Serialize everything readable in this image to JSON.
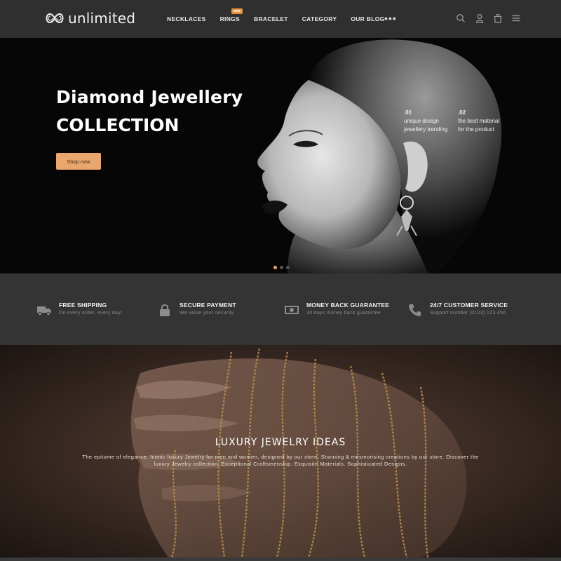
{
  "header": {
    "logo_text": "unlimited",
    "nav": [
      {
        "label": "NECKLACES"
      },
      {
        "label": "RINGS",
        "badge": "sale"
      },
      {
        "label": "BRACELET"
      },
      {
        "label": "CATEGORY"
      },
      {
        "label": "OUR BLOG"
      }
    ],
    "more_label": "•••",
    "icons": [
      "search-icon",
      "user-icon",
      "cart-icon",
      "menu-icon"
    ]
  },
  "hero": {
    "title": "Diamond Jewellery",
    "subtitle": "COLLECTION",
    "button_label": "Shop now",
    "features": [
      {
        "num": ".01",
        "line1": "unique design",
        "line2": "jewellery trending"
      },
      {
        "num": ".02",
        "line1": "the best material",
        "line2": "for the product"
      }
    ],
    "slides": 3,
    "active_slide": 1
  },
  "services": [
    {
      "icon": "truck-icon",
      "title": "FREE SHIPPING",
      "subtitle": "On every order, every day!"
    },
    {
      "icon": "lock-icon",
      "title": "SECURE PAYMENT",
      "subtitle": "We value your security"
    },
    {
      "icon": "money-icon",
      "title": "MONEY BACK GUARANTEE",
      "subtitle": "30 days money back guarantee"
    },
    {
      "icon": "phone-icon",
      "title": "24/7 CUSTOMER SERVICE",
      "subtitle": "Support number (0123) 123 456"
    }
  ],
  "luxury": {
    "title": "LUXURY JEWELRY IDEAS",
    "description": "The epitome of elegance. Iconic luxury Jewelry for men and women, designed by our store. Stunning & mesmorising creations by our store. Discover the luxury Jewelry collection. Exceptional Craftsmenship. Exquisite Materials. Sophisticated Designs."
  },
  "colors": {
    "accent": "#e9a76d",
    "badge": "#e6923d",
    "header_bg": "#2f2f2f",
    "services_bg": "#343434"
  }
}
